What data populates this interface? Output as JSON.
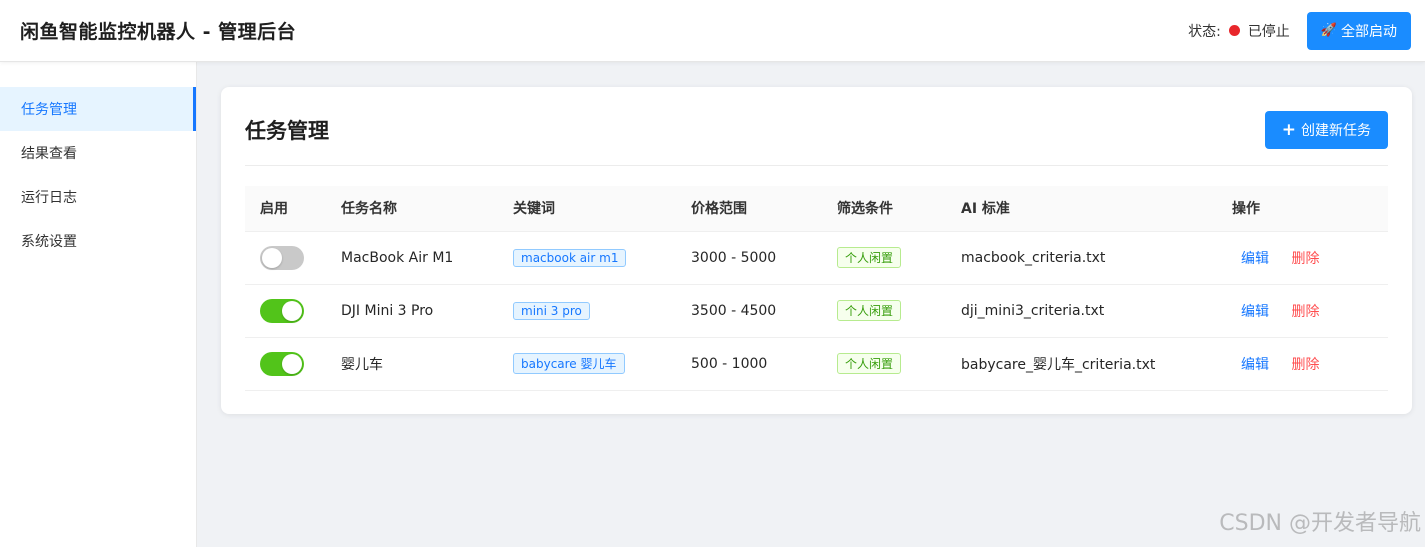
{
  "header": {
    "title": "闲鱼智能监控机器人 - 管理后台",
    "status_label": "状态:",
    "status_text": "已停止",
    "status_color": "#e8262b",
    "start_all_icon": "🚀",
    "start_all_label": "全部启动"
  },
  "sidebar": {
    "items": [
      {
        "label": "任务管理",
        "active": true
      },
      {
        "label": "结果查看",
        "active": false
      },
      {
        "label": "运行日志",
        "active": false
      },
      {
        "label": "系统设置",
        "active": false
      }
    ]
  },
  "main": {
    "title": "任务管理",
    "create_label": "创建新任务",
    "columns": [
      "启用",
      "任务名称",
      "关键词",
      "价格范围",
      "筛选条件",
      "AI 标准",
      "操作"
    ],
    "rows": [
      {
        "enabled": false,
        "name": "MacBook Air M1",
        "keyword": "macbook air m1",
        "price": "3000 - 5000",
        "filter": "个人闲置",
        "criteria": "macbook_criteria.txt",
        "edit": "编辑",
        "delete": "删除"
      },
      {
        "enabled": true,
        "name": "DJI Mini 3 Pro",
        "keyword": "mini 3 pro",
        "price": "3500 - 4500",
        "filter": "个人闲置",
        "criteria": "dji_mini3_criteria.txt",
        "edit": "编辑",
        "delete": "删除"
      },
      {
        "enabled": true,
        "name": "婴儿车",
        "keyword": "babycare 婴儿车",
        "price": "500 - 1000",
        "filter": "个人闲置",
        "criteria": "babycare_婴儿车_criteria.txt",
        "edit": "编辑",
        "delete": "删除"
      }
    ]
  },
  "watermark": "CSDN @开发者导航",
  "colors": {
    "primary": "#1a8cff",
    "toggle_on": "#52c41a",
    "toggle_off": "#c9c9c9",
    "danger": "#ff4d4f"
  }
}
